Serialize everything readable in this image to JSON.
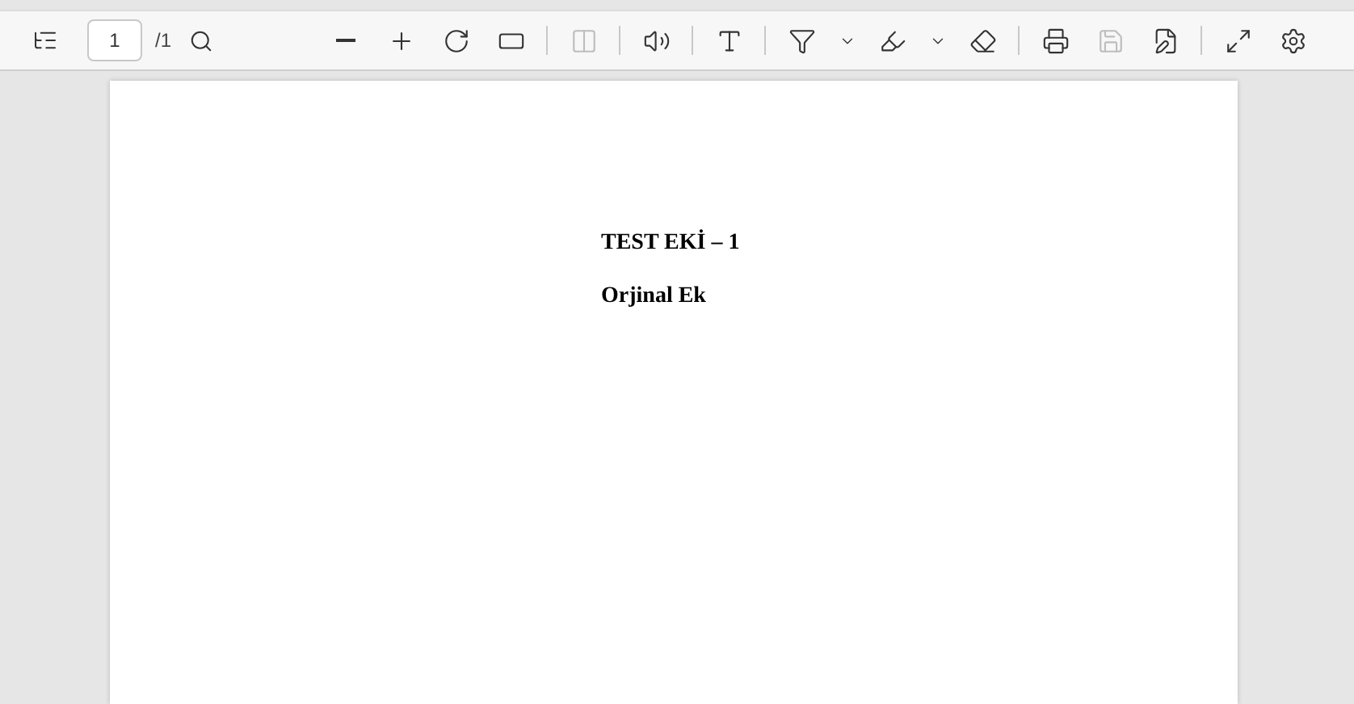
{
  "toolbar": {
    "page_input": {
      "value": "1"
    },
    "page_total": "/1",
    "tools": [
      {
        "kind": "zoom-out",
        "disabled": false
      },
      {
        "kind": "zoom-in",
        "disabled": false
      },
      {
        "kind": "rotate",
        "disabled": false
      },
      {
        "kind": "fit",
        "disabled": false
      },
      {
        "kind": "separator"
      },
      {
        "kind": "two-page",
        "disabled": true
      },
      {
        "kind": "separator"
      },
      {
        "kind": "read-aloud",
        "disabled": false
      },
      {
        "kind": "separator"
      },
      {
        "kind": "text-box",
        "disabled": false
      },
      {
        "kind": "separator"
      },
      {
        "kind": "draw",
        "disabled": false
      },
      {
        "kind": "dropdown",
        "disabled": false
      },
      {
        "kind": "highlight",
        "disabled": false
      },
      {
        "kind": "dropdown",
        "disabled": false
      },
      {
        "kind": "erase",
        "disabled": false
      },
      {
        "kind": "separator"
      },
      {
        "kind": "print",
        "disabled": false
      },
      {
        "kind": "save",
        "disabled": true
      },
      {
        "kind": "save-as",
        "disabled": false
      },
      {
        "kind": "separator"
      },
      {
        "kind": "fullscreen",
        "disabled": false
      },
      {
        "kind": "settings",
        "disabled": false
      }
    ]
  },
  "document": {
    "title": "TEST EKİ – 1",
    "subtitle": "Orjinal Ek"
  }
}
